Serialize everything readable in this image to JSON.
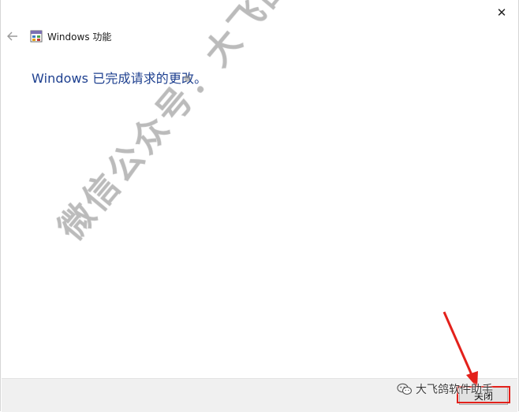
{
  "window": {
    "title": "Windows 功能",
    "close_glyph": "✕"
  },
  "icons": {
    "back": "back-arrow-icon",
    "app": "windows-features-icon",
    "wechat": "wechat-icon"
  },
  "main": {
    "message": "Windows 已完成请求的更改。"
  },
  "footer": {
    "close_label": "关闭"
  },
  "watermark": {
    "text": "微信公众号：大飞鸽软件助手"
  },
  "overlay": {
    "wechat_text": "大飞鸽软件助手",
    "highlight_color": "#e3211b"
  }
}
